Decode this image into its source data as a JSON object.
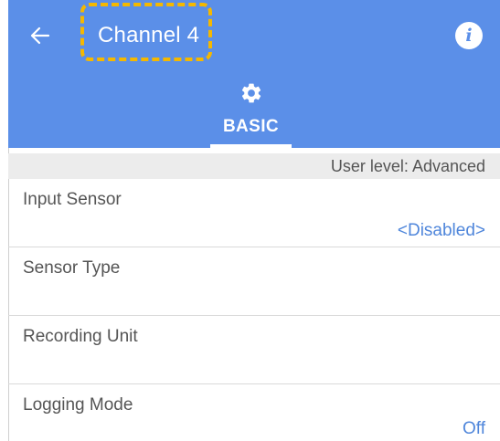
{
  "header": {
    "title": "Channel 4",
    "back_icon": "arrow-left-icon",
    "info_icon": "info-icon",
    "info_glyph": "i",
    "bar_color": "#5b8fe8",
    "highlight_color": "#f5b800"
  },
  "tabs": [
    {
      "label": "BASIC",
      "icon": "gear-icon",
      "selected": true
    }
  ],
  "user_level": "User level: Advanced",
  "settings": [
    {
      "label": "Input Sensor",
      "value": "<Disabled>"
    },
    {
      "label": "Sensor Type",
      "value": ""
    },
    {
      "label": "Recording Unit",
      "value": ""
    },
    {
      "label": "Logging Mode",
      "value": "Off"
    }
  ]
}
